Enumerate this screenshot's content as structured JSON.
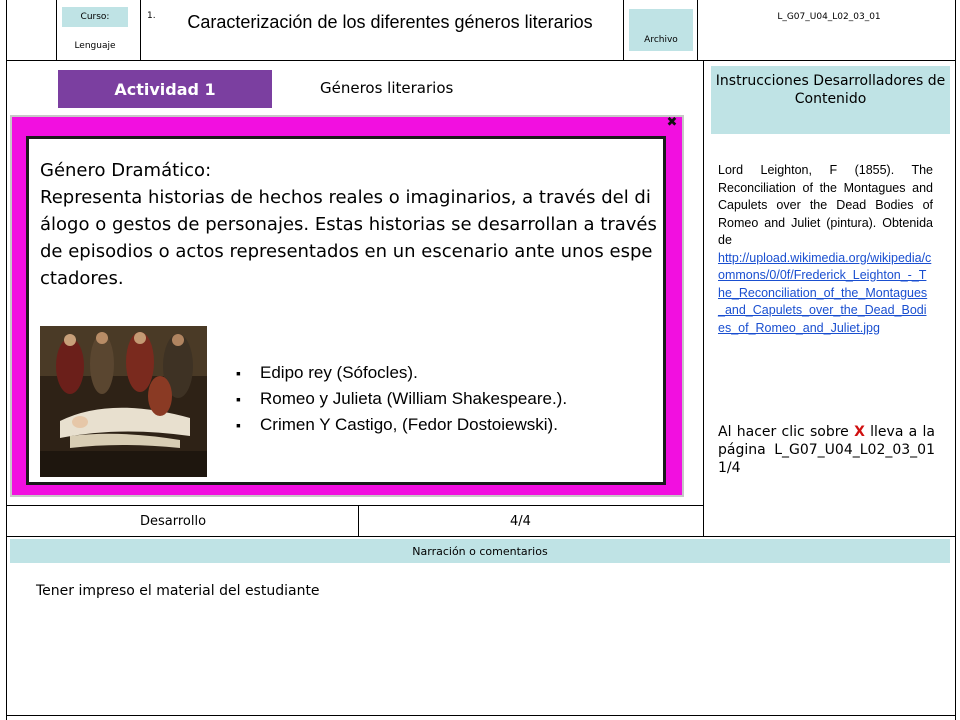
{
  "header": {
    "curso_label": "Curso:",
    "curso_value": "Lenguaje",
    "number": "1.",
    "title": "Caracterización de los diferentes géneros literarios",
    "archivo_label": "Archivo",
    "code": "L_G07_U04_L02_03_01"
  },
  "activity": {
    "badge": "Actividad 1",
    "subtitle": "Géneros literarios"
  },
  "instructions": {
    "title": "Instrucciones Desarrolladores de Contenido",
    "credit": "Lord Leighton, F (1855). The Reconciliation of the Montagues and Capulets over the Dead Bodies of Romeo and Juliet (pintura). Obtenida de",
    "link": "http://upload.wikimedia.org/wikipedia/commons/0/0f/Frederick_Leighton_-_The_Reconciliation_of_the_Montagues_and_Capulets_over_the_Dead_Bodies_of_Romeo_and_Juliet.jpg",
    "note_prefix": "Al hacer clic sobre",
    "note_x": "X",
    "note_suffix": "lleva a la página L_G07_U04_L02_03_01 1/4"
  },
  "popup": {
    "close": "✖",
    "genre_title": "Género Dramático:",
    "description": "Representa historias de hechos reales o imaginarios, a través del diálogo o gestos de personajes. Estas historias se desarrollan a través de episodios o actos representados en un escenario ante unos espectadores.",
    "works": [
      "Edipo rey (Sófocles).",
      "Romeo y Julieta (William Shakespeare.).",
      "Crimen Y Castigo, (Fedor Dostoiewski)."
    ]
  },
  "footer": {
    "dev_label": "Desarrollo",
    "page": "4/4",
    "narr_label": "Narración o comentarios",
    "narr_text": "Tener impreso el material del estudiante"
  },
  "colors": {
    "popup_pink": "#f20fe0",
    "badge_purple": "#7b3fa0",
    "teal_box": "#bfe3e5"
  }
}
